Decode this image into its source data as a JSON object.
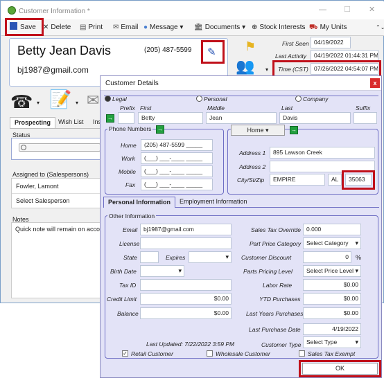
{
  "window": {
    "title": "Customer Information *"
  },
  "toolbar": {
    "save": "Save",
    "delete": "Delete",
    "print": "Print",
    "email": "Email",
    "message": "Message",
    "documents": "Documents",
    "stock_interests": "Stock Interests",
    "my_units": "My Units"
  },
  "customer": {
    "name": "Betty Jean Davis",
    "phone": "(205) 487-5599",
    "email": "bj1987@gmail.com"
  },
  "dates": {
    "first_seen_label": "First Seen",
    "first_seen": "04/19/2022",
    "last_activity_label": "Last Activity",
    "last_activity": "04/19/2022 01:44:31 PM",
    "time_label": "Time (CST)",
    "time": "07/26/2022 04:54:07 PM"
  },
  "left_tabs": {
    "prospecting": "Prospecting",
    "wish_list": "Wish List",
    "insurance": "Insu"
  },
  "status": {
    "label": "Status"
  },
  "assigned": {
    "label": "Assigned to (Salespersons)",
    "person": "Fowler, Lamont",
    "select": "Select Salesperson"
  },
  "notes": {
    "label": "Notes",
    "text": "Quick note will remain on accou"
  },
  "dialog": {
    "title": "Customer Details",
    "close": "x",
    "types": {
      "legal": "Legal",
      "personal": "Personal",
      "company": "Company"
    },
    "name_headers": {
      "prefix": "Prefix",
      "first": "First",
      "middle": "Middle",
      "last": "Last",
      "suffix": "Suffix"
    },
    "name_values": {
      "prefix": "",
      "first": "Betty",
      "middle": "Jean",
      "last": "Davis",
      "suffix": ""
    },
    "phones": {
      "label": "Phone Numbers",
      "home_label": "Home",
      "home": "(205) 487-5599 _____",
      "work_label": "Work",
      "work": "(___) ___-____ _____",
      "mobile_label": "Mobile",
      "mobile": "(___) ___-____ _____",
      "fax_label": "Fax",
      "fax": "(___) ___-____ _____"
    },
    "address": {
      "type": "Home",
      "addr1_label": "Address 1",
      "addr1": "895 Lawson Creek",
      "addr2_label": "Address 2",
      "addr2": "",
      "csz_label": "City/St/Zip",
      "city": "EMPIRE",
      "state": "AL",
      "zip": "35063"
    },
    "tabs": {
      "personal": "Personal Information",
      "employment": "Employment Information"
    },
    "other": {
      "label": "Other Information",
      "email_label": "Email",
      "email": "bj1987@gmail.com",
      "license_label": "License",
      "license": "",
      "state_label": "State",
      "state": "",
      "expires_label": "Expires",
      "expires": "",
      "birth_label": "Birth Date",
      "birth": "",
      "taxid_label": "Tax ID",
      "taxid": "",
      "credit_label": "Credit Limit",
      "credit": "$0.00",
      "balance_label": "Balance",
      "balance": "$0.00",
      "updated": "Last Updated: 7/22/2022 3:59 PM",
      "sales_tax_override_label": "Sales Tax Override",
      "sales_tax_override": "0.000",
      "part_price_label": "Part Price Category",
      "part_price": "Select Category",
      "discount_label": "Customer Discount",
      "discount": "0",
      "discount_unit": "%",
      "parts_pricing_label": "Parts Pricing Level",
      "parts_pricing": "Select Price Level",
      "labor_rate_label": "Labor Rate",
      "labor_rate": "$0.00",
      "ytd_label": "YTD Purchases",
      "ytd": "$0.00",
      "last_years_label": "Last Years Purchases",
      "last_years": "$0.00",
      "last_purchase_label": "Last Purchase Date",
      "last_purchase": "4/19/2022",
      "cust_type_label": "Customer Type",
      "cust_type": "Select Type",
      "retail": "Retail Customer",
      "wholesale": "Wholesale Customer",
      "exempt": "Sales Tax Exempt"
    },
    "ok": "OK"
  }
}
